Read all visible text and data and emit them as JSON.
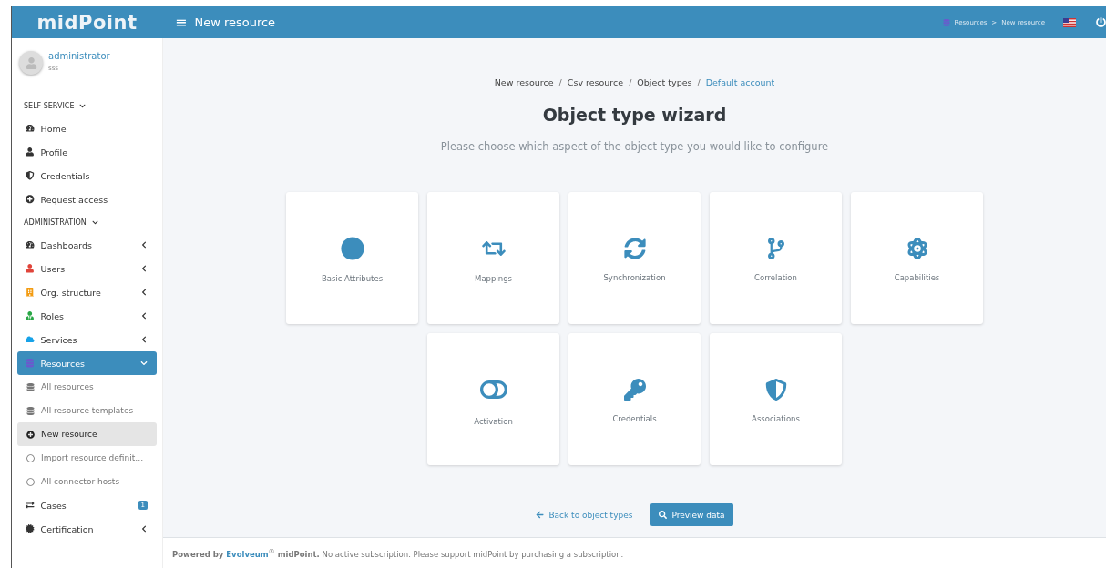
{
  "header": {
    "logo": "midPoint",
    "menu_toggle": "≡",
    "title": "New resource",
    "breadcrumbs": [
      {
        "label": "Resources",
        "separator": ">"
      },
      {
        "label": "New resource"
      }
    ]
  },
  "user": {
    "name": "administrator",
    "subtitle": "sss"
  },
  "sidebar": {
    "sections": [
      {
        "title": "SELF SERVICE",
        "expanded": true,
        "items": [
          {
            "label": "Home",
            "selected": false
          },
          {
            "label": "Profile",
            "selected": false
          },
          {
            "label": "Credentials",
            "selected": false
          },
          {
            "label": "Request access",
            "selected": false
          }
        ]
      },
      {
        "title": "ADMINISTRATION",
        "expanded": true,
        "items": [
          {
            "label": "Dashboards",
            "selected": false,
            "expanded": false
          },
          {
            "label": "Users",
            "selected": false,
            "expanded": false
          },
          {
            "label": "Org. structure",
            "selected": false,
            "expanded": false
          },
          {
            "label": "Roles",
            "selected": false,
            "expanded": false
          },
          {
            "label": "Services",
            "selected": false,
            "expanded": false
          },
          {
            "label": "Resources",
            "selected": true,
            "expanded": true,
            "children": [
              {
                "label": "All resources",
                "selected": false
              },
              {
                "label": "All resource templates",
                "selected": false
              },
              {
                "label": "New resource",
                "selected": true
              },
              {
                "label": "Import resource definit…",
                "selected": false
              },
              {
                "label": "All connector hosts",
                "selected": false
              }
            ]
          },
          {
            "label": "Cases",
            "selected": false,
            "badge": "1"
          },
          {
            "label": "Certification",
            "selected": false,
            "expanded": false
          }
        ]
      }
    ]
  },
  "breadcrumb": [
    {
      "label": "New resource",
      "current": false
    },
    {
      "label": "Csv resource",
      "current": false
    },
    {
      "label": "Object types",
      "current": false
    },
    {
      "label": "Default account",
      "current": true
    }
  ],
  "breadcrumb_separator": "/",
  "title": "Object type wizard",
  "subtitle": "Please choose which aspect of the object type you would like to configure",
  "tiles": [
    {
      "label": "Basic Attributes"
    },
    {
      "label": "Mappings"
    },
    {
      "label": "Synchronization"
    },
    {
      "label": "Correlation"
    },
    {
      "label": "Capabilities"
    },
    {
      "label": "Activation"
    },
    {
      "label": "Credentials"
    },
    {
      "label": "Associations"
    }
  ],
  "actions": {
    "back": "Back to object types",
    "preview": "Preview data"
  },
  "footer": {
    "powered_by": "Powered by",
    "link": "Evolveum",
    "mark": "®",
    "product": "midPoint.",
    "message": "No active subscription. Please support midPoint by purchasing a subscription."
  }
}
